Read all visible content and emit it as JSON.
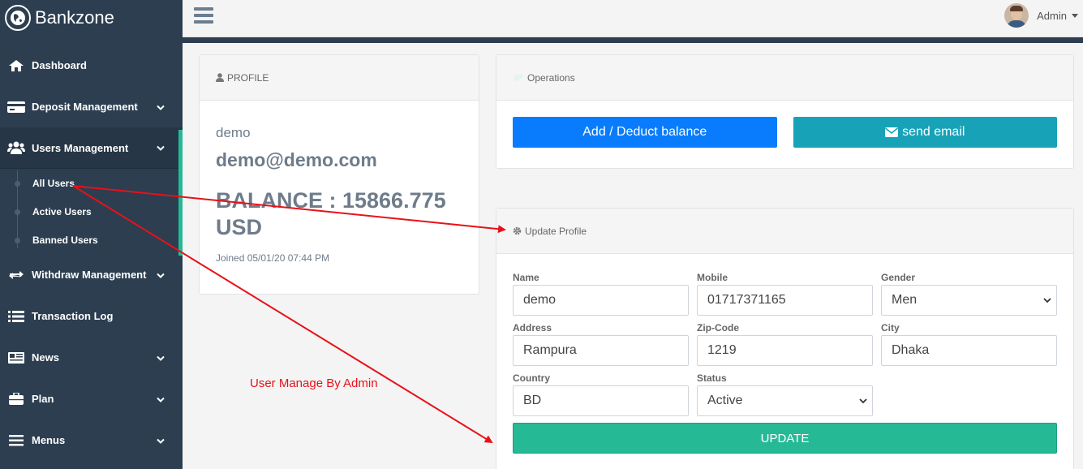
{
  "brand": {
    "name": "Bankzone",
    "icon": "globe-icon"
  },
  "sidebar": {
    "items": [
      {
        "label": "Dashboard",
        "icon": "home-icon"
      },
      {
        "label": "Deposit Management",
        "icon": "credit-card-icon"
      },
      {
        "label": "Users Management",
        "icon": "users-icon"
      },
      {
        "label": "Withdraw Management",
        "icon": "exchange-icon"
      },
      {
        "label": "Transaction Log",
        "icon": "list-icon"
      },
      {
        "label": "News",
        "icon": "newspaper-icon"
      },
      {
        "label": "Plan",
        "icon": "briefcase-icon"
      },
      {
        "label": "Menus",
        "icon": "bars-icon"
      }
    ],
    "users_sub": [
      "All Users",
      "Active Users",
      "Banned Users"
    ]
  },
  "topbar": {
    "user_name": "Admin"
  },
  "profile": {
    "title": "PROFILE",
    "username": "demo",
    "email": "demo@demo.com",
    "balance": "BALANCE : 15866.775 USD",
    "joined": "Joined 05/01/20 07:44 PM"
  },
  "operations": {
    "title": "Operations",
    "add_deduct": "Add / Deduct balance",
    "send_email": "send email"
  },
  "update_profile": {
    "title": "Update Profile",
    "fields": {
      "name": {
        "label": "Name",
        "value": "demo"
      },
      "mobile": {
        "label": "Mobile",
        "value": "01717371165"
      },
      "gender": {
        "label": "Gender",
        "value": "Men"
      },
      "address": {
        "label": "Address",
        "value": "Rampura"
      },
      "zip": {
        "label": "Zip-Code",
        "value": "1219"
      },
      "city": {
        "label": "City",
        "value": "Dhaka"
      },
      "country": {
        "label": "Country",
        "value": "BD"
      },
      "status": {
        "label": "Status",
        "value": "Active"
      }
    },
    "update_button": "UPDATE"
  },
  "annotation": "User Manage By Admin",
  "colors": {
    "sidebar": "#2c3e50",
    "accent": "#26b996",
    "primary": "#087cfc",
    "info": "#17a2b8",
    "arrow": "#e8111a"
  }
}
